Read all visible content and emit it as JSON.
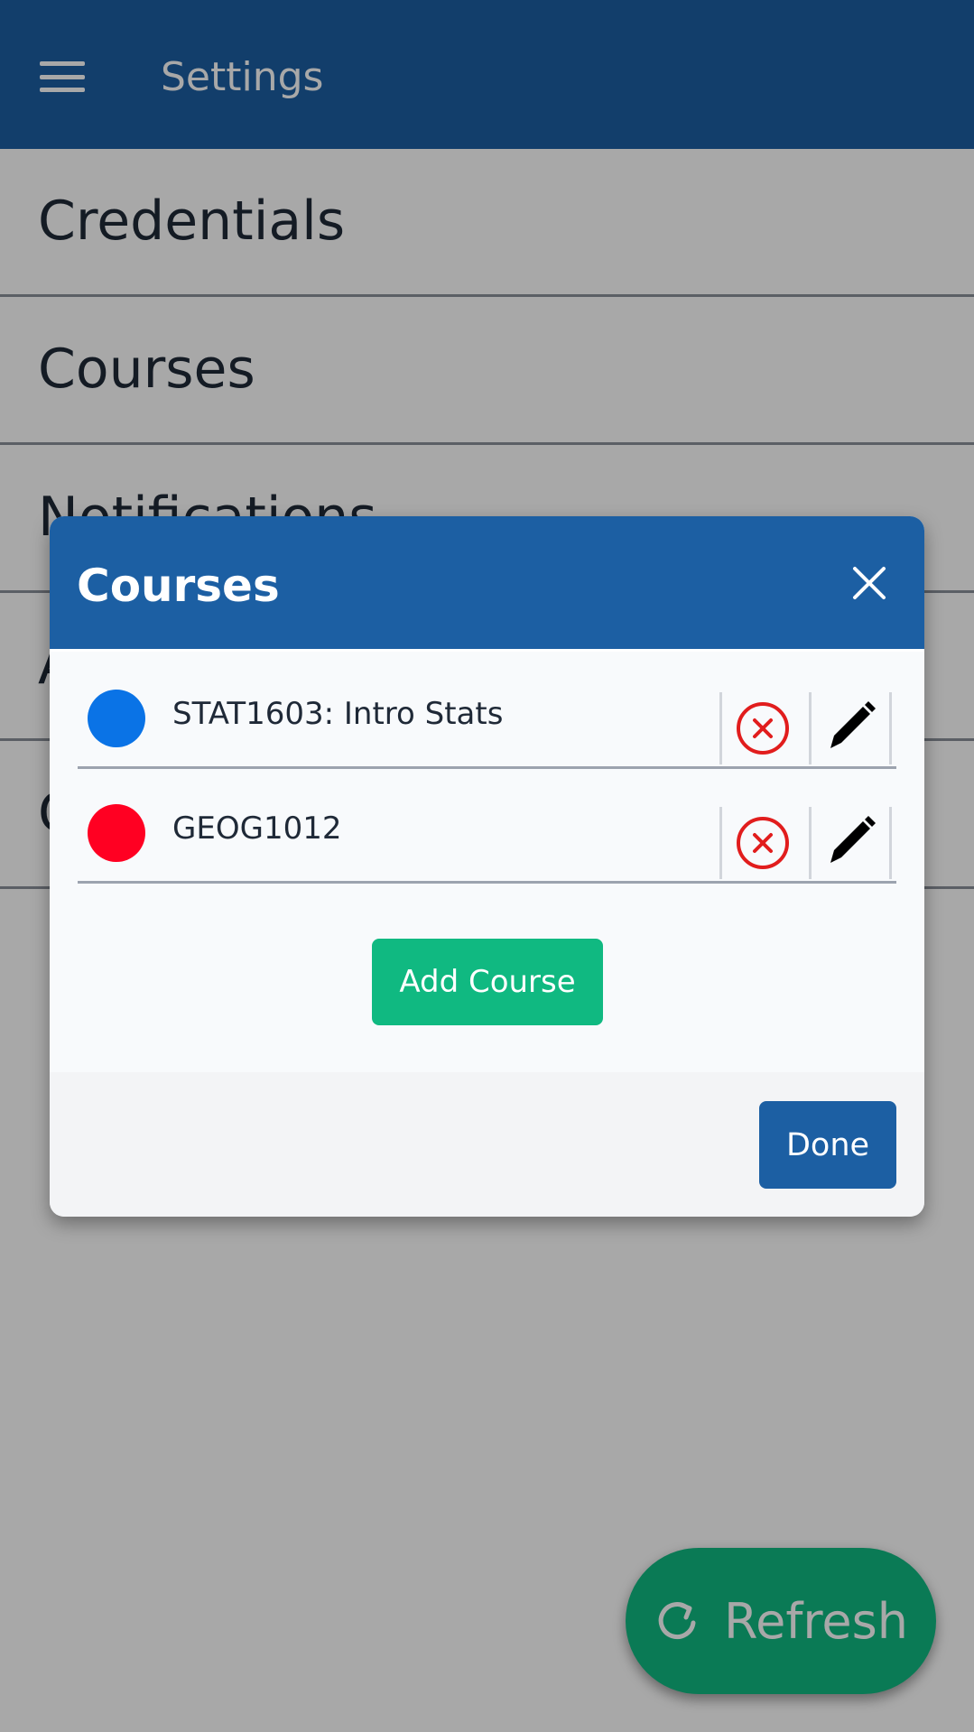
{
  "appbar": {
    "title": "Settings",
    "menu_icon": "hamburger-menu-icon"
  },
  "settings": {
    "items": [
      {
        "label": "Credentials"
      },
      {
        "label": "Courses"
      },
      {
        "label": "Notifications"
      },
      {
        "label": "A"
      },
      {
        "label": "C"
      }
    ]
  },
  "fab": {
    "label": "Refresh",
    "icon": "refresh-icon"
  },
  "modal": {
    "title": "Courses",
    "close_icon": "close-icon",
    "courses": [
      {
        "name": "STAT1603: Intro Stats",
        "color": "#0a73e6"
      },
      {
        "name": "GEOG1012",
        "color": "#ff0022"
      }
    ],
    "remove_icon": "remove-circle-icon",
    "edit_icon": "pencil-icon",
    "add_label": "Add Course",
    "done_label": "Done"
  },
  "colors": {
    "primary": "#1c5fa3",
    "accent_green": "#10b981",
    "danger": "#e11d1d"
  }
}
